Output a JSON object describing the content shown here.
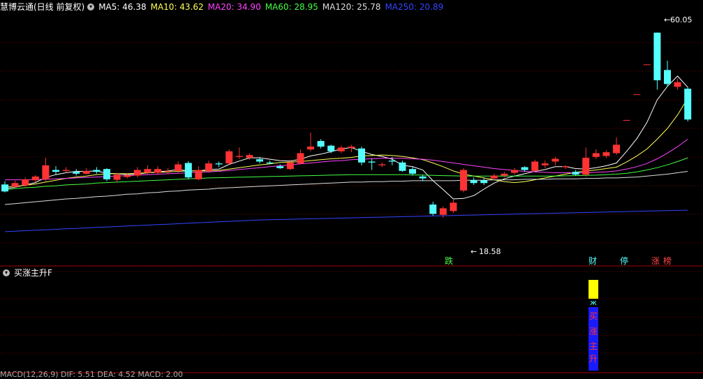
{
  "header": {
    "title": "慧博云通(日线 前复权)",
    "ma": [
      {
        "label": "MA5: 46.38",
        "color": "#ffffff"
      },
      {
        "label": "MA10: 43.62",
        "color": "#ffff55"
      },
      {
        "label": "MA20: 34.90",
        "color": "#ff44ff"
      },
      {
        "label": "MA60: 28.95",
        "color": "#44ff44"
      },
      {
        "label": "MA120: 25.78",
        "color": "#dddddd"
      },
      {
        "label": "MA250: 20.89",
        "color": "#3344ff"
      }
    ]
  },
  "sub": {
    "title": "买涨主升F",
    "signal_text": [
      "买",
      "涨",
      "主",
      "升"
    ]
  },
  "bottom": {
    "text": "MACD(12,26,9)  DIF: 5.51  DEA: 4.52  MACD: 2.00"
  },
  "annotations": {
    "high": "60.05",
    "low": "18.58"
  },
  "markers": [
    {
      "text": "跌",
      "color": "#44ff44",
      "x": 643
    },
    {
      "text": "财",
      "color": "#55ffff",
      "x": 849
    },
    {
      "text": "停",
      "color": "#55ffff",
      "x": 894
    },
    {
      "text": "涨",
      "color": "#ff4444",
      "x": 939
    },
    {
      "text": "榜",
      "color": "#ff4444",
      "x": 956
    }
  ],
  "colors": {
    "up": "#ff3333",
    "down": "#55ffff",
    "grid": "#7a0000"
  },
  "chart_data": {
    "type": "candlestick",
    "ylim": [
      12,
      64
    ],
    "candles": [
      [
        27.5,
        26.0,
        28.2,
        25.8
      ],
      [
        27.0,
        27.8,
        28.3,
        26.8
      ],
      [
        27.3,
        28.6,
        29.0,
        27.0
      ],
      [
        28.4,
        29.2,
        29.5,
        28.0
      ],
      [
        28.6,
        31.6,
        33.2,
        28.2
      ],
      [
        30.6,
        30.2,
        31.4,
        29.6
      ],
      [
        30.4,
        30.6,
        31.2,
        30.0
      ],
      [
        30.2,
        29.8,
        30.8,
        29.4
      ],
      [
        29.8,
        30.4,
        31.0,
        29.6
      ],
      [
        30.6,
        30.2,
        31.2,
        29.8
      ],
      [
        30.8,
        28.6,
        31.0,
        28.2
      ],
      [
        28.5,
        29.6,
        30.0,
        28.0
      ],
      [
        29.1,
        29.5,
        29.8,
        28.8
      ],
      [
        29.4,
        30.6,
        31.2,
        29.0
      ],
      [
        30.0,
        30.8,
        31.6,
        29.6
      ],
      [
        30.0,
        30.8,
        31.4,
        29.6
      ],
      [
        30.4,
        30.4,
        31.0,
        29.8
      ],
      [
        30.4,
        31.8,
        32.4,
        30.0
      ],
      [
        32.1,
        29.0,
        32.5,
        28.6
      ],
      [
        28.6,
        30.6,
        31.4,
        28.4
      ],
      [
        30.4,
        32.0,
        32.6,
        30.0
      ],
      [
        32.0,
        31.8,
        32.4,
        31.2
      ],
      [
        32.0,
        34.6,
        35.0,
        31.8
      ],
      [
        33.4,
        33.6,
        35.4,
        33.0
      ],
      [
        33.2,
        33.8,
        34.2,
        32.8
      ],
      [
        32.9,
        32.4,
        33.4,
        32.0
      ],
      [
        32.2,
        32.0,
        32.6,
        31.8
      ],
      [
        31.4,
        31.0,
        31.8,
        30.8
      ],
      [
        30.8,
        32.2,
        32.8,
        30.6
      ],
      [
        32.0,
        34.2,
        35.0,
        31.8
      ],
      [
        35.0,
        35.6,
        38.6,
        34.6
      ],
      [
        36.8,
        35.6,
        37.2,
        35.2
      ],
      [
        35.8,
        34.6,
        36.0,
        34.2
      ],
      [
        34.6,
        35.4,
        35.8,
        34.2
      ],
      [
        35.3,
        35.6,
        36.0,
        34.4
      ],
      [
        35.2,
        32.2,
        35.6,
        31.6
      ],
      [
        32.4,
        32.2,
        33.0,
        30.6
      ],
      [
        31.6,
        31.8,
        32.2,
        31.2
      ],
      [
        32.6,
        32.4,
        33.4,
        31.6
      ],
      [
        32.2,
        30.4,
        32.6,
        30.2
      ],
      [
        30.8,
        29.8,
        31.2,
        29.4
      ],
      [
        29.2,
        28.8,
        29.6,
        28.2
      ],
      [
        23.2,
        21.2,
        23.8,
        20.8
      ],
      [
        21.0,
        22.4,
        22.8,
        20.4
      ],
      [
        21.8,
        23.6,
        24.2,
        21.4
      ],
      [
        26.2,
        30.6,
        31.0,
        25.8
      ],
      [
        28.4,
        27.8,
        29.0,
        27.4
      ],
      [
        28.4,
        27.8,
        29.0,
        27.4
      ],
      [
        28.8,
        29.4,
        29.8,
        28.4
      ],
      [
        29.4,
        29.8,
        30.2,
        29.0
      ],
      [
        30.0,
        30.6,
        31.0,
        29.6
      ],
      [
        31.2,
        30.6,
        31.4,
        30.2
      ],
      [
        30.4,
        32.4,
        32.8,
        30.2
      ],
      [
        31.6,
        32.0,
        32.6,
        31.0
      ],
      [
        32.4,
        33.0,
        33.4,
        31.6
      ],
      [
        31.2,
        31.4,
        31.6,
        30.8
      ],
      [
        30.2,
        29.6,
        30.6,
        29.4
      ],
      [
        29.6,
        33.2,
        35.4,
        29.2
      ],
      [
        33.4,
        34.2,
        35.0,
        33.0
      ],
      [
        33.6,
        34.4,
        34.8,
        33.2
      ],
      [
        34.2,
        36.0,
        37.6,
        33.8
      ],
      [
        41.3,
        41.3,
        41.3,
        41.3
      ],
      [
        46.8,
        46.8,
        46.8,
        46.8
      ],
      [
        53.2,
        53.2,
        53.2,
        53.2
      ],
      [
        60.0,
        49.8,
        60.05,
        47.8
      ],
      [
        52.0,
        49.0,
        54.0,
        48.4
      ],
      [
        48.4,
        49.4,
        50.2,
        47.8
      ],
      [
        48.0,
        41.4,
        48.4,
        41.0
      ]
    ],
    "ma5": [
      26.6,
      26.9,
      27.4,
      27.9,
      29.0,
      29.6,
      30.0,
      30.3,
      30.3,
      30.4,
      29.9,
      29.8,
      29.6,
      29.7,
      30.0,
      30.2,
      30.4,
      30.7,
      30.4,
      30.4,
      30.7,
      30.8,
      31.8,
      32.5,
      33.2,
      33.2,
      32.9,
      32.6,
      32.5,
      32.9,
      33.6,
      34.0,
      34.5,
      35.1,
      35.4,
      34.6,
      33.9,
      33.5,
      32.9,
      31.6,
      31.3,
      30.6,
      28.3,
      26.4,
      24.4,
      24.5,
      25.1,
      26.5,
      27.8,
      28.7,
      29.3,
      29.8,
      30.3,
      30.7,
      31.3,
      31.3,
      30.9,
      30.8,
      31.1,
      31.5,
      32.1,
      34.6,
      37.3,
      40.8,
      45.6,
      48.5,
      50.7,
      48.3
    ],
    "ma10": [
      27.0,
      27.1,
      27.3,
      27.6,
      28.0,
      28.4,
      28.8,
      29.1,
      29.3,
      29.6,
      29.8,
      29.8,
      29.8,
      29.9,
      30.0,
      30.1,
      30.2,
      30.3,
      30.4,
      30.4,
      30.4,
      30.5,
      30.8,
      31.1,
      31.4,
      31.7,
      31.9,
      32.2,
      32.3,
      32.4,
      32.6,
      32.8,
      33.0,
      33.1,
      33.3,
      33.6,
      33.7,
      33.8,
      33.7,
      33.5,
      33.2,
      32.8,
      32.1,
      31.3,
      30.4,
      29.7,
      29.3,
      28.9,
      28.5,
      28.1,
      27.9,
      28.1,
      28.5,
      28.9,
      29.3,
      29.7,
      30.1,
      30.4,
      30.6,
      30.9,
      31.2,
      32.3,
      33.6,
      35.1,
      37.2,
      39.5,
      42.4,
      46.0
    ],
    "ma20": [
      28.5,
      28.5,
      28.5,
      28.6,
      28.6,
      28.7,
      28.8,
      28.9,
      29.0,
      29.1,
      29.2,
      29.3,
      29.4,
      29.5,
      29.6,
      29.7,
      29.8,
      29.9,
      30.0,
      30.1,
      30.2,
      30.3,
      30.5,
      30.7,
      30.9,
      31.1,
      31.3,
      31.5,
      31.7,
      31.9,
      32.1,
      32.3,
      32.5,
      32.6,
      32.8,
      32.9,
      33.0,
      33.1,
      33.1,
      33.1,
      33.0,
      32.9,
      32.7,
      32.4,
      32.1,
      31.8,
      31.5,
      31.2,
      30.9,
      30.7,
      30.5,
      30.3,
      30.2,
      30.1,
      30.0,
      30.0,
      30.0,
      30.0,
      30.1,
      30.2,
      30.4,
      30.8,
      31.3,
      32.0,
      33.0,
      34.2,
      35.6,
      37.2
    ],
    "ma60": [
      26.4,
      26.6,
      26.8,
      26.9,
      27.1,
      27.2,
      27.4,
      27.5,
      27.6,
      27.8,
      27.9,
      28.0,
      28.1,
      28.2,
      28.3,
      28.4,
      28.5,
      28.6,
      28.7,
      28.8,
      28.9,
      28.95,
      29.0,
      29.05,
      29.1,
      29.15,
      29.2,
      29.25,
      29.3,
      29.35,
      29.4,
      29.45,
      29.5,
      29.55,
      29.6,
      29.6,
      29.6,
      29.6,
      29.6,
      29.6,
      29.55,
      29.5,
      29.45,
      29.4,
      29.35,
      29.3,
      29.3,
      29.3,
      29.3,
      29.3,
      29.3,
      29.3,
      29.3,
      29.3,
      29.3,
      29.35,
      29.4,
      29.45,
      29.5,
      29.6,
      29.7,
      29.9,
      30.2,
      30.6,
      31.1,
      31.7,
      32.4,
      33.2
    ],
    "ma120": [
      23.2,
      23.4,
      23.6,
      23.8,
      24.0,
      24.2,
      24.4,
      24.5,
      24.7,
      24.9,
      25.0,
      25.2,
      25.4,
      25.5,
      25.7,
      25.8,
      26.0,
      26.1,
      26.3,
      26.4,
      26.5,
      26.7,
      26.8,
      26.9,
      27.0,
      27.1,
      27.2,
      27.3,
      27.4,
      27.5,
      27.6,
      27.7,
      27.8,
      27.9,
      28.0,
      28.0,
      28.1,
      28.1,
      28.2,
      28.2,
      28.3,
      28.3,
      28.3,
      28.3,
      28.3,
      28.4,
      28.4,
      28.4,
      28.5,
      28.5,
      28.5,
      28.6,
      28.6,
      28.6,
      28.7,
      28.7,
      28.7,
      28.8,
      28.8,
      28.9,
      28.9,
      29.0,
      29.1,
      29.3,
      29.5,
      29.7,
      30.0,
      30.3
    ],
    "ma250": [
      17.4,
      17.5,
      17.6,
      17.7,
      17.8,
      17.9,
      18.0,
      18.1,
      18.2,
      18.3,
      18.4,
      18.5,
      18.6,
      18.7,
      18.8,
      18.9,
      19.0,
      19.1,
      19.2,
      19.3,
      19.4,
      19.5,
      19.6,
      19.7,
      19.8,
      19.9,
      19.95,
      20.0,
      20.05,
      20.1,
      20.15,
      20.2,
      20.25,
      20.3,
      20.35,
      20.4,
      20.45,
      20.5,
      20.55,
      20.6,
      20.65,
      20.7,
      20.75,
      20.8,
      20.85,
      20.9,
      20.95,
      21.0,
      21.05,
      21.1,
      21.15,
      21.2,
      21.25,
      21.3,
      21.35,
      21.4,
      21.45,
      21.5,
      21.55,
      21.6,
      21.65,
      21.7,
      21.75,
      21.8,
      21.85,
      21.9,
      21.95,
      22.0
    ]
  }
}
